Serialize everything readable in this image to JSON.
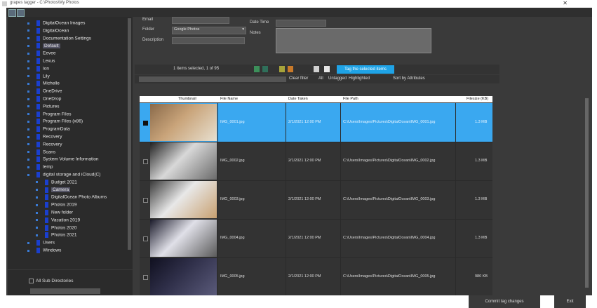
{
  "window": {
    "title": "grapes tagger - C:\\Photos\\My Photos"
  },
  "sidebar": {
    "items": [
      {
        "label": "DigitalOcean Images",
        "indent": 0,
        "selected": false
      },
      {
        "label": "DigitalOcean",
        "indent": 0,
        "selected": false
      },
      {
        "label": "Documentation Settings",
        "indent": 0,
        "selected": false
      },
      {
        "label": "Default",
        "indent": 0,
        "selected": true
      },
      {
        "label": "Eevee",
        "indent": 0,
        "selected": false
      },
      {
        "label": "Lexus",
        "indent": 0,
        "selected": false
      },
      {
        "label": "Ion",
        "indent": 0,
        "selected": false
      },
      {
        "label": "Lily",
        "indent": 0,
        "selected": false
      },
      {
        "label": "Michelle",
        "indent": 0,
        "selected": false
      },
      {
        "label": "OneDrive",
        "indent": 0,
        "selected": false
      },
      {
        "label": "OneDrop",
        "indent": 0,
        "selected": false
      },
      {
        "label": "Pictures",
        "indent": 0,
        "selected": false
      },
      {
        "label": "Program Files",
        "indent": 0,
        "selected": false
      },
      {
        "label": "Program Files (x86)",
        "indent": 0,
        "selected": false
      },
      {
        "label": "ProgramData",
        "indent": 0,
        "selected": false
      },
      {
        "label": "Recovery",
        "indent": 0,
        "selected": false
      },
      {
        "label": "Recovery",
        "indent": 0,
        "selected": false
      },
      {
        "label": "Scans",
        "indent": 0,
        "selected": false
      },
      {
        "label": "System Volume Information",
        "indent": 0,
        "selected": false
      },
      {
        "label": "temp",
        "indent": 0,
        "selected": false
      },
      {
        "label": "digital storage and iCloud(C)",
        "indent": 0,
        "selected": false
      },
      {
        "label": "Budget 2021",
        "indent": 1,
        "selected": false
      },
      {
        "label": "Camera",
        "indent": 1,
        "selected": true
      },
      {
        "label": "DigitalOcean Photo Albums",
        "indent": 1,
        "selected": false
      },
      {
        "label": "Photos 2019",
        "indent": 1,
        "selected": false
      },
      {
        "label": "New folder",
        "indent": 1,
        "selected": false
      },
      {
        "label": "Vacation 2019",
        "indent": 1,
        "selected": false
      },
      {
        "label": "Photos 2020",
        "indent": 1,
        "selected": false
      },
      {
        "label": "Photos 2021",
        "indent": 1,
        "selected": false
      },
      {
        "label": "Users",
        "indent": 0,
        "selected": false
      },
      {
        "label": "Windows",
        "indent": 0,
        "selected": false
      }
    ],
    "all_images_label": "All Sub Directories"
  },
  "details": {
    "email_label": "Email",
    "folder_label": "Folder",
    "folder_value": "Google Photos",
    "description_label": "Description",
    "date_label": "Date Time",
    "notes_label": "Notes"
  },
  "gallery_bar": {
    "selection_text": "1 items selected, 1 of 95",
    "tag_button": "Tag the selected items"
  },
  "filter_bar": {
    "search_placeholder": "Search...",
    "clear_label": "Clear filter",
    "all_label": "All",
    "untagged_label": "Untagged",
    "tagged_label": "Highlighted",
    "sort_label": "Sort by Attributes"
  },
  "grid": {
    "columns": [
      "Thumbnail",
      "File Name",
      "Date Taken",
      "File Path",
      "Filesize (KB)"
    ],
    "rows": [
      {
        "file_name": "IMG_0001.jpg",
        "date": "2/1/2021 12:00 PM",
        "path": "C:\\Users\\Images\\Pictures\\DigitalOcean\\IMG_0001.jpg",
        "size": "1.3 MB",
        "selected": true,
        "checked": true
      },
      {
        "file_name": "IMG_0002.jpg",
        "date": "2/1/2021 12:00 PM",
        "path": "C:\\Users\\Images\\Pictures\\DigitalOcean\\IMG_0002.jpg",
        "size": "1.3 MB",
        "selected": false,
        "checked": false
      },
      {
        "file_name": "IMG_0003.jpg",
        "date": "2/1/2021 12:00 PM",
        "path": "C:\\Users\\Images\\Pictures\\DigitalOcean\\IMG_0003.jpg",
        "size": "1.3 MB",
        "selected": false,
        "checked": false
      },
      {
        "file_name": "IMG_0004.jpg",
        "date": "2/1/2021 12:00 PM",
        "path": "C:\\Users\\Images\\Pictures\\DigitalOcean\\IMG_0004.jpg",
        "size": "1.3 MB",
        "selected": false,
        "checked": false
      },
      {
        "file_name": "IMG_0005.jpg",
        "date": "2/1/2021 12:00 PM",
        "path": "C:\\Users\\Images\\Pictures\\DigitalOcean\\IMG_0005.jpg",
        "size": "980 KB",
        "selected": false,
        "checked": false
      }
    ]
  },
  "status": {
    "primary_button": "Commit tag changes",
    "secondary_button": "Exit"
  },
  "colors": {
    "accent": "#1fa3e6",
    "selection": "#3aa8f0",
    "tree_marker": "#1a3fcf",
    "panel": "#3a3a3a"
  }
}
